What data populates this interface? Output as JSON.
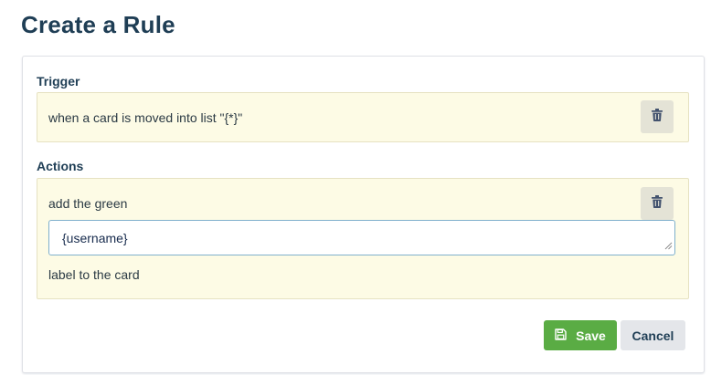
{
  "page": {
    "title": "Create a Rule"
  },
  "trigger": {
    "label": "Trigger",
    "text": "when a card is moved into list \"{*}\"",
    "delete_icon": "trash-icon"
  },
  "actions": {
    "label": "Actions",
    "items": [
      {
        "text_before": "add the green",
        "input_value": "{username}",
        "text_after": "label to the card",
        "delete_icon": "trash-icon"
      }
    ]
  },
  "footer": {
    "save_label": "Save",
    "save_icon": "floppy-disk-icon",
    "cancel_label": "Cancel"
  },
  "colors": {
    "title": "#1f3e55",
    "box_background": "#fdfbe5",
    "save_button": "#5aac44",
    "cancel_button": "#e4e6ea",
    "input_border": "#7fb0cc"
  }
}
